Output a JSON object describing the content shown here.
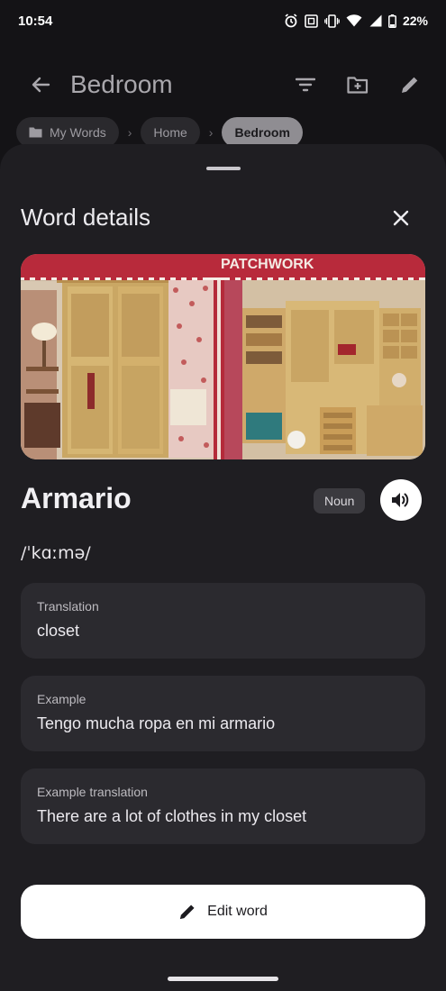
{
  "status": {
    "time": "10:54",
    "battery": "22%",
    "icons": [
      "alarm-icon",
      "nfc-icon",
      "vibrate-icon",
      "wifi-icon",
      "signal-icon",
      "battery-icon"
    ]
  },
  "app_bar": {
    "title": "Bedroom",
    "back_icon": "arrow-back-icon",
    "actions": [
      "filter-icon",
      "add-folder-icon",
      "edit-pencil-icon"
    ]
  },
  "breadcrumbs": {
    "items": [
      {
        "label": "My Words",
        "icon": "folder-icon"
      },
      {
        "label": "Home"
      },
      {
        "label": "Bedroom",
        "active": true
      }
    ]
  },
  "sheet": {
    "title": "Word details",
    "image_sign": "PATCHWORK",
    "word": "Armario",
    "part_of_speech": "Noun",
    "phonetic": "/ˈkɑːmə/",
    "fields": [
      {
        "label": "Translation",
        "value": "closet"
      },
      {
        "label": "Example",
        "value": "Tengo mucha ropa en mi armario"
      },
      {
        "label": "Example translation",
        "value": "There are a lot of clothes in my closet"
      }
    ],
    "edit_button": "Edit word"
  },
  "colors": {
    "background": "#141316",
    "sheet": "#1f1e22",
    "field": "#2b2a2f",
    "button": "#ffffff"
  }
}
